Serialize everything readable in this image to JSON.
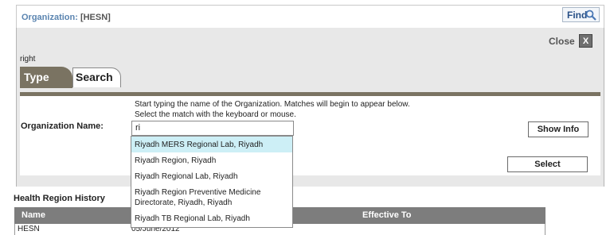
{
  "header": {
    "title_label": "Organization:",
    "title_value": "[HESN]",
    "find_label": "Find"
  },
  "dialog": {
    "close_label": "Close",
    "close_x": "X",
    "right_label": "right",
    "tabs": [
      {
        "label": "Type"
      },
      {
        "label": "Search"
      }
    ],
    "hint_line1": "Start typing the name of the Organization. Matches will begin to appear below.",
    "hint_line2": "Select the match with the keyboard or mouse.",
    "org_name_label": "Organization Name:",
    "org_name_value": "ri",
    "show_info_label": "Show Info",
    "select_label": "Select"
  },
  "autocomplete": {
    "items": [
      {
        "label": "Riyadh MERS Regional Lab, Riyadh",
        "selected": true
      },
      {
        "label": "Riyadh Region, Riyadh",
        "selected": false
      },
      {
        "label": "Riyadh Regional Lab, Riyadh",
        "selected": false
      },
      {
        "label": "Riyadh Region Preventive Medicine Directorate, Riyadh, Riyadh",
        "selected": false
      },
      {
        "label": "Riyadh TB Regional Lab, Riyadh",
        "selected": false
      }
    ]
  },
  "history": {
    "title": "Health Region History",
    "columns": [
      "Name",
      "",
      "Effective To"
    ],
    "rows": [
      {
        "name": "HESN",
        "from": "05/June/2012",
        "to": ""
      }
    ]
  },
  "colors": {
    "accent": "#7a7362",
    "link": "#5a84b0",
    "highlight": "#cdeff6",
    "header_bg": "#7d7d7d"
  }
}
